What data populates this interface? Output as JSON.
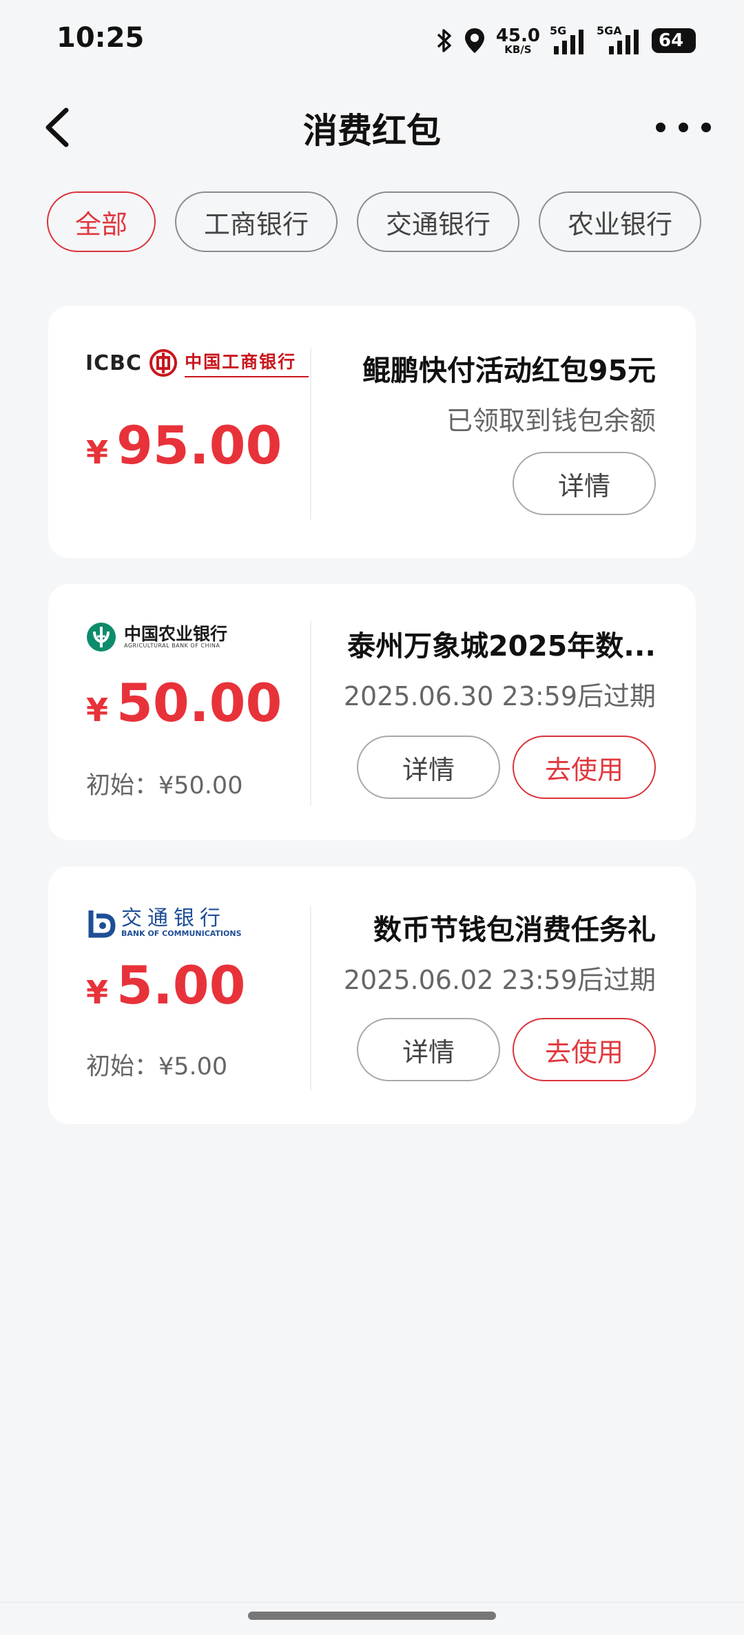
{
  "status_bar": {
    "time": "10:25",
    "net_speed": "45.0",
    "net_speed_unit": "KB/S",
    "signal1_label": "5G",
    "signal2_label": "5GA",
    "battery": "64"
  },
  "nav": {
    "title": "消费红包"
  },
  "tabs": [
    {
      "label": "全部",
      "active": true
    },
    {
      "label": "工商银行",
      "active": false
    },
    {
      "label": "交通银行",
      "active": false
    },
    {
      "label": "农业银行",
      "active": false
    }
  ],
  "cards": [
    {
      "bank": "中国工商银行",
      "bank_logo_text": "ICBC",
      "currency": "¥",
      "amount": "95.00",
      "title": "鲲鹏快付活动红包95元",
      "subtitle": "已领取到钱包余额",
      "detail_label": "详情"
    },
    {
      "bank": "中国农业银行",
      "bank_en": "AGRICULTURAL BANK OF CHINA",
      "currency": "¥",
      "amount": "50.00",
      "initial": "初始：¥50.00",
      "title": "泰州万象城2025年数...",
      "subtitle": "2025.06.30 23:59后过期",
      "detail_label": "详情",
      "use_label": "去使用"
    },
    {
      "bank": "交通银行",
      "bank_en": "BANK OF COMMUNICATIONS",
      "currency": "¥",
      "amount": "5.00",
      "initial": "初始：¥5.00",
      "title": "数币节钱包消费任务礼",
      "subtitle": "2025.06.02 23:59后过期",
      "detail_label": "详情",
      "use_label": "去使用"
    }
  ],
  "colors": {
    "accent": "#e8323a",
    "icbc_red": "#c8161d",
    "abc_green": "#0d8c6b",
    "bocom_blue": "#1f4e96",
    "background": "#f5f6f8"
  }
}
